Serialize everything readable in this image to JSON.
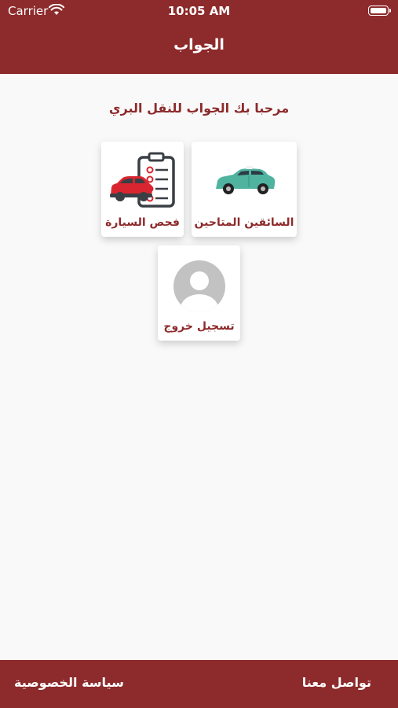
{
  "status_bar": {
    "carrier": "Carrier",
    "time": "10:05 AM"
  },
  "header": {
    "title": "الجواب"
  },
  "main": {
    "welcome": "مرحبا بك الجواب للنقل البري",
    "cards": [
      {
        "label": "السائقين المتاحين",
        "icon": "taxi-car-icon"
      },
      {
        "label": "فحص السيارة",
        "icon": "car-inspection-checklist-icon"
      },
      {
        "label": "تسجيل خروج",
        "icon": "user-avatar-icon"
      }
    ]
  },
  "footer": {
    "privacy": "سياسة الخصوصية",
    "contact": "تواصل معنا"
  },
  "colors": {
    "brand": "#8d2a2b",
    "background": "#f9f9f9",
    "card": "#ffffff",
    "taxi": "#4fb3a0",
    "inspection_car": "#d9252f"
  }
}
